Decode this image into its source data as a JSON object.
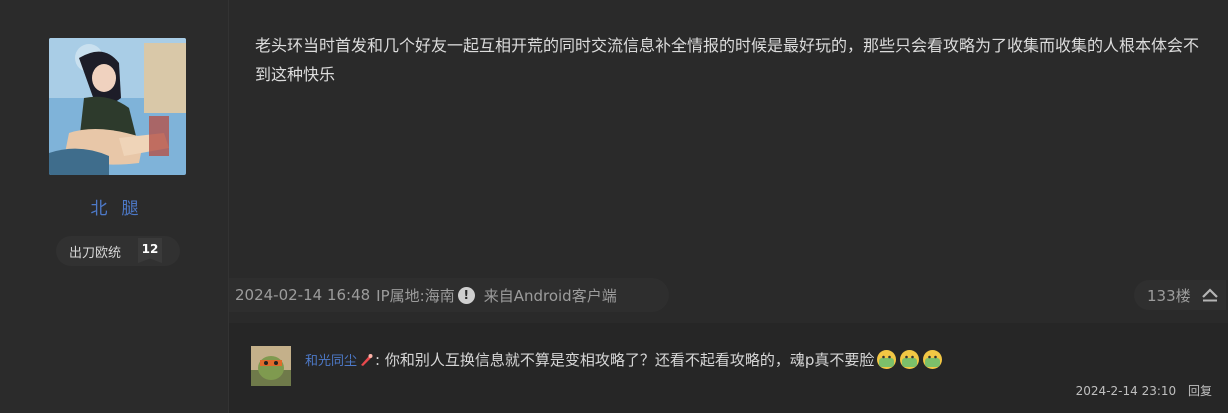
{
  "author": {
    "name": "北腿",
    "badge_name": "出刀欧统",
    "badge_level": "12"
  },
  "post": {
    "content": "老头环当时首发和几个好友一起互相开荒的同时交流信息补全情报的时候是最好玩的，那些只会看攻略为了收集而收集的人根本体会不到这种快乐",
    "date": "2024-02-14 16:48",
    "ip": "IP属地:海南",
    "client": "来自Android客户端",
    "floor": "133楼"
  },
  "reply": {
    "user": "和光同尘",
    "text": ": 你和别人互换信息就不算是变相攻略了？还看不起看攻略的，魂p真不要脸",
    "time": "2024-2-14 23:10",
    "reply_label": "回复"
  },
  "colors": {
    "username": "#4d79c8",
    "background": "#2a2a2a",
    "reply_bg": "#262626"
  },
  "icons": [
    "warning-icon",
    "collapse-up-icon",
    "user-title-icon",
    "face-emoji-icon"
  ]
}
